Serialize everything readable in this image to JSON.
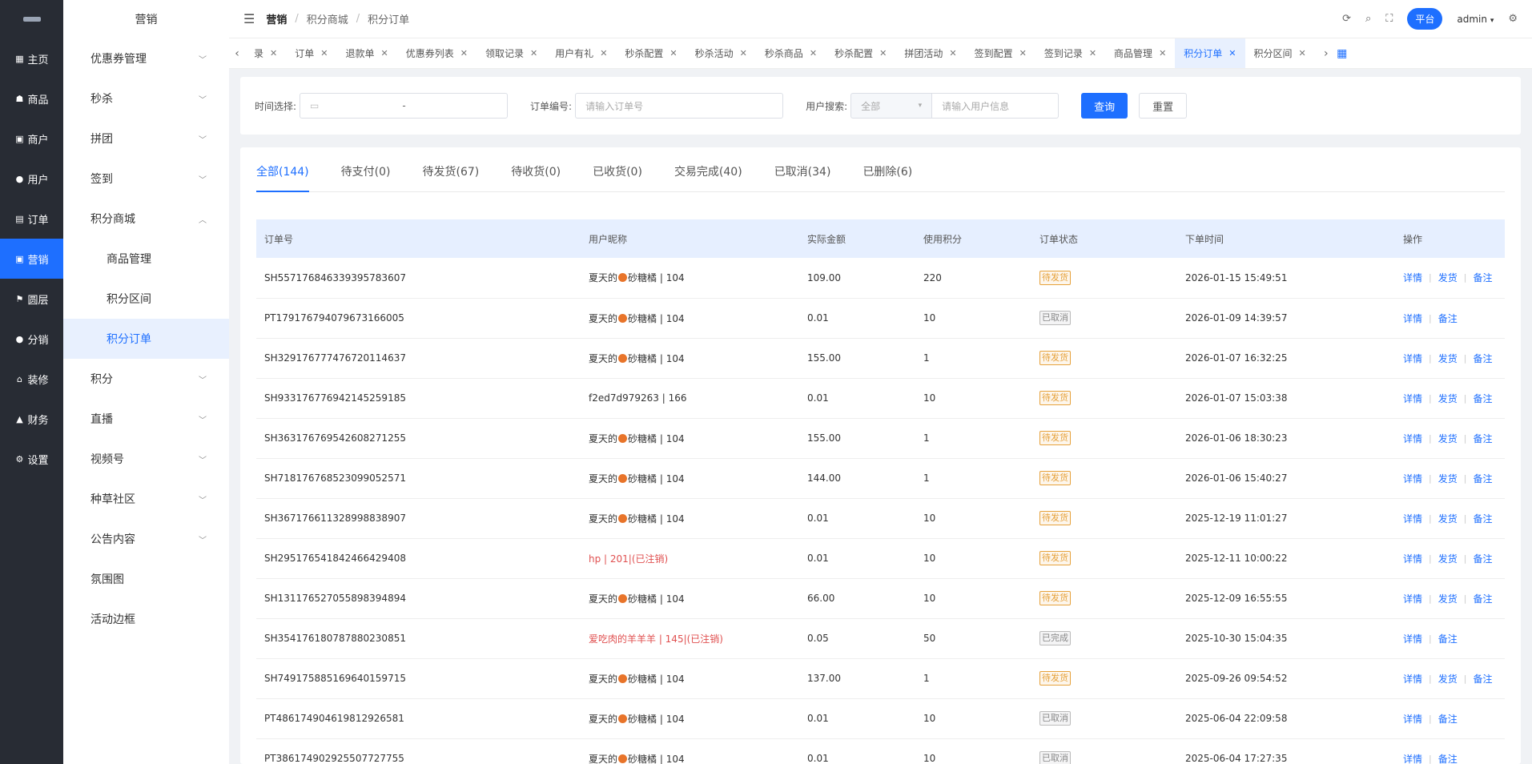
{
  "rail": {
    "items": [
      {
        "label": "主页",
        "icon": "grid-icon"
      },
      {
        "label": "商品",
        "icon": "bag-icon"
      },
      {
        "label": "商户",
        "icon": "store-icon"
      },
      {
        "label": "用户",
        "icon": "user-icon"
      },
      {
        "label": "订单",
        "icon": "order-icon"
      },
      {
        "label": "营销",
        "icon": "marketing-icon",
        "active": true
      },
      {
        "label": "圆层",
        "icon": "flag-icon"
      },
      {
        "label": "分销",
        "icon": "person-icon"
      },
      {
        "label": "装修",
        "icon": "home-icon"
      },
      {
        "label": "财务",
        "icon": "finance-icon"
      },
      {
        "label": "设置",
        "icon": "gear-icon"
      }
    ]
  },
  "sidebar": {
    "title": "营销",
    "items": [
      {
        "label": "优惠券管理",
        "chevron": "down"
      },
      {
        "label": "秒杀",
        "chevron": "down"
      },
      {
        "label": "拼团",
        "chevron": "down"
      },
      {
        "label": "签到",
        "chevron": "down"
      },
      {
        "label": "积分商城",
        "chevron": "up"
      },
      {
        "label": "商品管理",
        "child": true
      },
      {
        "label": "积分区间",
        "child": true
      },
      {
        "label": "积分订单",
        "child": true,
        "active": true
      },
      {
        "label": "积分",
        "chevron": "down"
      },
      {
        "label": "直播",
        "chevron": "down"
      },
      {
        "label": "视频号",
        "chevron": "down"
      },
      {
        "label": "种草社区",
        "chevron": "down"
      },
      {
        "label": "公告内容",
        "chevron": "down"
      },
      {
        "label": "氛围图"
      },
      {
        "label": "活动边框"
      }
    ]
  },
  "header": {
    "breadcrumb": [
      "营销",
      "积分商城",
      "积分订单"
    ],
    "platform_label": "平台",
    "user": "admin"
  },
  "tabs": {
    "items": [
      {
        "label": "录"
      },
      {
        "label": "订单"
      },
      {
        "label": "退款单"
      },
      {
        "label": "优惠券列表"
      },
      {
        "label": "领取记录"
      },
      {
        "label": "用户有礼"
      },
      {
        "label": "秒杀配置"
      },
      {
        "label": "秒杀活动"
      },
      {
        "label": "秒杀商品"
      },
      {
        "label": "秒杀配置"
      },
      {
        "label": "拼团活动"
      },
      {
        "label": "签到配置"
      },
      {
        "label": "签到记录"
      },
      {
        "label": "商品管理"
      },
      {
        "label": "积分订单",
        "active": true
      },
      {
        "label": "积分区间"
      }
    ]
  },
  "filter": {
    "time_label": "时间选择:",
    "time_sep": "-",
    "order_label": "订单编号:",
    "order_placeholder": "请输入订单号",
    "user_label": "用户搜索:",
    "user_select_value": "全部",
    "user_placeholder": "请输入用户信息",
    "query_button": "查询",
    "reset_button": "重置"
  },
  "status_tabs": [
    {
      "label": "全部(144)",
      "active": true
    },
    {
      "label": "待支付(0)"
    },
    {
      "label": "待发货(67)"
    },
    {
      "label": "待收货(0)"
    },
    {
      "label": "已收货(0)"
    },
    {
      "label": "交易完成(40)"
    },
    {
      "label": "已取消(34)"
    },
    {
      "label": "已删除(6)"
    }
  ],
  "table": {
    "headers": [
      "订单号",
      "用户昵称",
      "实际金额",
      "使用积分",
      "订单状态",
      "下单时间",
      "操作"
    ],
    "op_labels": {
      "detail": "详情",
      "ship": "发货",
      "remark": "备注"
    },
    "rows": [
      {
        "order_no": "SH557176846339395783607",
        "nick_pre": "夏天的",
        "nick_post": "砂糖橘 | 104",
        "amount": "109.00",
        "points": "220",
        "status": "待发货",
        "status_type": "wait",
        "time": "2026-01-15 15:49:51",
        "ship": true
      },
      {
        "order_no": "PT179176794079673166005",
        "nick_pre": "夏天的",
        "nick_post": "砂糖橘 | 104",
        "amount": "0.01",
        "points": "10",
        "status": "已取消",
        "status_type": "gray",
        "time": "2026-01-09 14:39:57",
        "ship": false
      },
      {
        "order_no": "SH329176777476720114637",
        "nick_pre": "夏天的",
        "nick_post": "砂糖橘 | 104",
        "amount": "155.00",
        "points": "1",
        "status": "待发货",
        "status_type": "wait",
        "time": "2026-01-07 16:32:25",
        "ship": true
      },
      {
        "order_no": "SH933176776942145259185",
        "nick_pre": "f2ed7d979263 | 166",
        "nick_post": "",
        "plain": true,
        "amount": "0.01",
        "points": "10",
        "status": "待发货",
        "status_type": "wait",
        "time": "2026-01-07 15:03:38",
        "ship": true
      },
      {
        "order_no": "SH363176769542608271255",
        "nick_pre": "夏天的",
        "nick_post": "砂糖橘 | 104",
        "amount": "155.00",
        "points": "1",
        "status": "待发货",
        "status_type": "wait",
        "time": "2026-01-06 18:30:23",
        "ship": true
      },
      {
        "order_no": "SH718176768523099052571",
        "nick_pre": "夏天的",
        "nick_post": "砂糖橘 | 104",
        "amount": "144.00",
        "points": "1",
        "status": "待发货",
        "status_type": "wait",
        "time": "2026-01-06 15:40:27",
        "ship": true
      },
      {
        "order_no": "SH367176611328998838907",
        "nick_pre": "夏天的",
        "nick_post": "砂糖橘 | 104",
        "amount": "0.01",
        "points": "10",
        "status": "待发货",
        "status_type": "wait",
        "time": "2025-12-19 11:01:27",
        "ship": true
      },
      {
        "order_no": "SH295176541842466429408",
        "nick_pre": "hp | 201|(已注销)",
        "nick_post": "",
        "plain": true,
        "deleted": true,
        "amount": "0.01",
        "points": "10",
        "status": "待发货",
        "status_type": "wait",
        "time": "2025-12-11 10:00:22",
        "ship": true
      },
      {
        "order_no": "SH131176527055898394894",
        "nick_pre": "夏天的",
        "nick_post": "砂糖橘 | 104",
        "amount": "66.00",
        "points": "10",
        "status": "待发货",
        "status_type": "wait",
        "time": "2025-12-09 16:55:55",
        "ship": true
      },
      {
        "order_no": "SH354176180787880230851",
        "nick_pre": "爱吃肉的羊羊羊 | 145|(已注销)",
        "nick_post": "",
        "plain": true,
        "deleted": true,
        "amount": "0.05",
        "points": "50",
        "status": "已完成",
        "status_type": "gray",
        "time": "2025-10-30 15:04:35",
        "ship": false
      },
      {
        "order_no": "SH749175885169640159715",
        "nick_pre": "夏天的",
        "nick_post": "砂糖橘 | 104",
        "amount": "137.00",
        "points": "1",
        "status": "待发货",
        "status_type": "wait",
        "time": "2025-09-26 09:54:52",
        "ship": true
      },
      {
        "order_no": "PT486174904619812926581",
        "nick_pre": "夏天的",
        "nick_post": "砂糖橘 | 104",
        "amount": "0.01",
        "points": "10",
        "status": "已取消",
        "status_type": "gray",
        "time": "2025-06-04 22:09:58",
        "ship": false
      },
      {
        "order_no": "PT386174902925507727755",
        "nick_pre": "夏天的",
        "nick_post": "砂糖橘 | 104",
        "amount": "0.01",
        "points": "10",
        "status": "已取消",
        "status_type": "gray",
        "time": "2025-06-04 17:27:35",
        "ship": false
      }
    ]
  }
}
